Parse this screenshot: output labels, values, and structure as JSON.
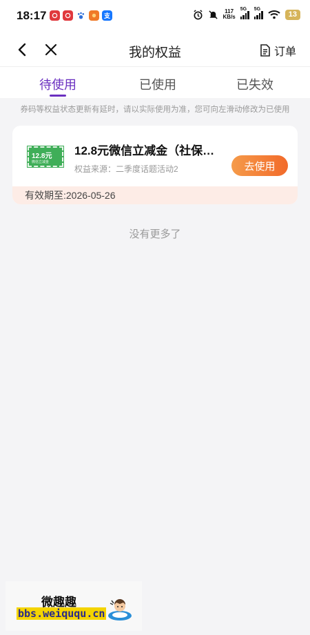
{
  "status_bar": {
    "time": "18:17",
    "net_speed_value": "117",
    "net_speed_unit": "KB/s",
    "signal_1_label": "5G",
    "signal_2_label": "5G",
    "battery": "13",
    "apps": [
      {
        "icon": "netease-music-icon",
        "glyph": "",
        "color": "#e0393e"
      },
      {
        "icon": "netease-music-icon",
        "glyph": "",
        "color": "#e0393e"
      },
      {
        "icon": "baidu-paw-icon",
        "glyph": "",
        "color": "#2f6fd8"
      },
      {
        "icon": "taobao-icon",
        "glyph": "",
        "color": "#f07a28"
      },
      {
        "icon": "alipay-icon",
        "glyph": "支",
        "color": "#1677ff"
      }
    ]
  },
  "nav": {
    "title": "我的权益",
    "order_label": "订单"
  },
  "tabs": [
    {
      "label": "待使用",
      "active": true
    },
    {
      "label": "已使用",
      "active": false
    },
    {
      "label": "已失效",
      "active": false
    }
  ],
  "notice": "券码等权益状态更新有延时，请以实际使用为准，您可向左滑动修改为已使用",
  "benefit": {
    "coupon_value": "12.8元",
    "coupon_subtext": "微信立减金",
    "title": "12.8元微信立减金（社保…",
    "source": "权益来源：二季度话题活动2",
    "use_button": "去使用",
    "expiry": "有效期至:2026-05-26"
  },
  "no_more_text": "没有更多了",
  "watermark": {
    "title": "微趣趣",
    "url": "bbs.weiququ.cn"
  },
  "colors": {
    "accent": "#6a2fc0",
    "button_start": "#f59b4a",
    "button_end": "#f26a2a",
    "expiry_bg": "#fdece6",
    "coupon_green": "#3fae58"
  }
}
